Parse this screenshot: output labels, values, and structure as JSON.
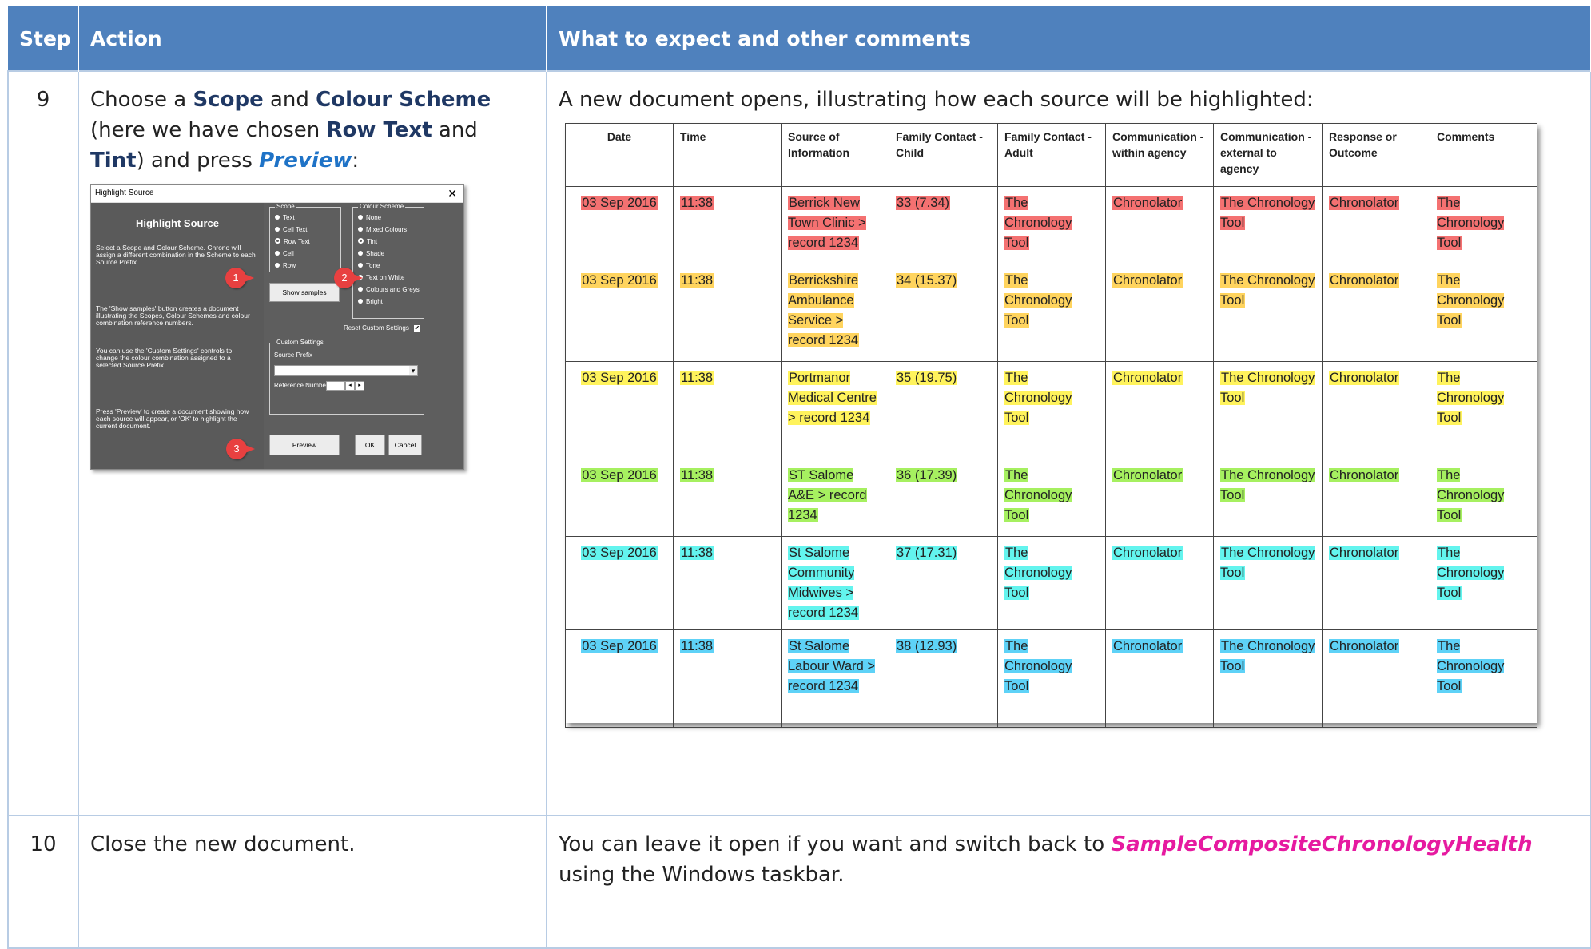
{
  "header": {
    "step": "Step",
    "action": "Action",
    "expect": "What to expect and other comments"
  },
  "step9": {
    "number": "9",
    "action": {
      "p1": "Choose a ",
      "scope": "Scope",
      "p2": " and ",
      "colour_scheme": "Colour Scheme",
      "p3": " (here we have chosen ",
      "row_text": "Row Text",
      "p4": " and ",
      "tint": "Tint",
      "p5": ") and press ",
      "preview": "Preview",
      "p6": ":"
    },
    "expect": "A new document opens, illustrating how each source will be highlighted:"
  },
  "dialog": {
    "title": "Highlight Source",
    "close": "✕",
    "heading": "Highlight Source",
    "desc1": "Select a Scope and Colour Scheme. Chrono will assign a different combination in the Scheme to each Source Prefix.",
    "desc2": "The 'Show samples' button creates a document illustrating the Scopes, Colour Schemes and colour combination reference numbers.",
    "desc3": "You can use the 'Custom Settings' controls to change the colour combination assigned to a selected Source Prefix.",
    "desc4": "Press 'Preview' to create a document showing how each source will appear, or 'OK' to highlight the current document.",
    "scope_group": "Scope",
    "scope_options": [
      "Text",
      "Cell Text",
      "Row Text",
      "Cell",
      "Row"
    ],
    "scheme_group": "Colour Scheme",
    "scheme_options": [
      "None",
      "Mixed Colours",
      "Tint",
      "Shade",
      "Tone",
      "Text on White",
      "Colours and Greys",
      "Bright"
    ],
    "reset_label": "Reset Custom Settings",
    "reset_check": "✔",
    "show_samples": "Show samples",
    "custom_group": "Custom Settings",
    "source_prefix": "Source Prefix",
    "dropdown_arrow": "▾",
    "reference_number": "Reference Number",
    "spin_down": "◂",
    "spin_up": "▸",
    "preview_btn": "Preview",
    "ok_btn": "OK",
    "cancel_btn": "Cancel",
    "markers": [
      "1",
      "2",
      "3"
    ]
  },
  "preview_table": {
    "headers": [
      "Date",
      "Time",
      "Source of Information",
      "Family Contact - Child",
      "Family Contact - Adult",
      "Communication - within agency",
      "Communication - external to agency",
      "Response or Outcome",
      "Comments"
    ],
    "rows": [
      {
        "color": "#f47171",
        "date": "03 Sep 2016",
        "time": "11:38",
        "source": "Berrick New Town Clinic  > record 1234",
        "child": "33 (7.34)",
        "adult": "The Chronology Tool",
        "within": "Chronolator",
        "external": "The Chronology Tool",
        "response": "Chronolator",
        "comments": "The Chronology Tool"
      },
      {
        "color": "#ffd45e",
        "date": "03 Sep 2016",
        "time": "11:38",
        "source": "Berrickshire Ambulance Service  > record 1234",
        "child": "34 (15.37)",
        "adult": "The Chronology Tool",
        "within": "Chronolator",
        "external": "The Chronology Tool",
        "response": "Chronolator",
        "comments": "The Chronology Tool"
      },
      {
        "color": "#fff35c",
        "date": "03 Sep 2016",
        "time": "11:38",
        "source": "Portmanor Medical Centre  > record 1234",
        "child": "35 (19.75)",
        "adult": "The Chronology Tool",
        "within": "Chronolator",
        "external": "The Chronology Tool",
        "response": "Chronolator",
        "comments": "The Chronology Tool"
      },
      {
        "color": "#a6f060",
        "date": "03 Sep 2016",
        "time": "11:38",
        "source": "ST Salome A&E  > record 1234",
        "child": "36 (17.39)",
        "adult": "The Chronology Tool",
        "within": "Chronolator",
        "external": "The Chronology Tool",
        "response": "Chronolator",
        "comments": "The Chronology Tool"
      },
      {
        "color": "#63f4ee",
        "date": "03 Sep 2016",
        "time": "11:38",
        "source": "St Salome Community Midwives  > record 1234",
        "child": "37 (17.31)",
        "adult": "The Chronology Tool",
        "within": "Chronolator",
        "external": "The Chronology Tool",
        "response": "Chronolator",
        "comments": "The Chronology Tool"
      },
      {
        "color": "#5ed2f7",
        "date": "03 Sep 2016",
        "time": "11:38",
        "source": "St Salome Labour Ward  > record 1234",
        "child": "38 (12.93)",
        "adult": "The Chronology Tool",
        "within": "Chronolator",
        "external": "The Chronology Tool",
        "response": "Chronolator",
        "comments": "The Chronology Tool"
      }
    ]
  },
  "step10": {
    "number": "10",
    "action": "Close the new document.",
    "expect_p1": "You can leave it open if you want and switch back to ",
    "doc_name": "SampleCompositeChronologyHealth",
    "expect_p2": " using the Windows taskbar."
  }
}
